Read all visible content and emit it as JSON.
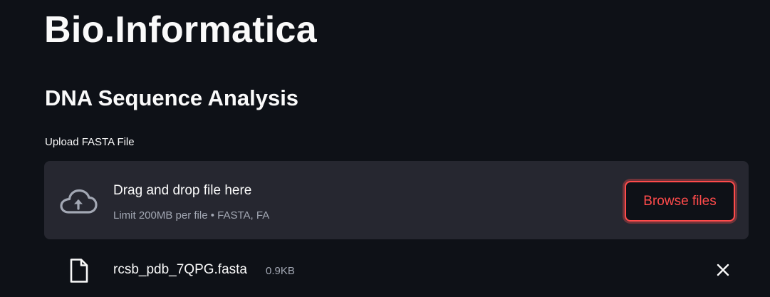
{
  "header": {
    "title": "Bio.Informatica",
    "subtitle": "DNA Sequence Analysis"
  },
  "uploader": {
    "label": "Upload FASTA File",
    "dropzone_text": "Drag and drop file here",
    "limit_text": "Limit 200MB per file • FASTA, FA",
    "browse_label": "Browse files",
    "icon": "cloud-upload-icon"
  },
  "uploaded_file": {
    "name": "rcsb_pdb_7QPG.fasta",
    "size": "0.9KB",
    "icon": "file-icon",
    "remove_icon": "close-icon"
  },
  "colors": {
    "background": "#0e1117",
    "dropzone_background": "#262730",
    "accent": "#ff4b4b",
    "text": "#fafafa",
    "muted_text": "#a3a8b4"
  }
}
